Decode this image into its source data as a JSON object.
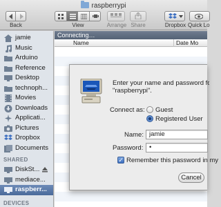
{
  "window": {
    "title": "raspberrypi"
  },
  "toolbar": {
    "back_label": "Back",
    "view_label": "View",
    "arrange_label": "Arrange",
    "share_label": "Share",
    "dropbox_label": "Dropbox",
    "quicklook_label": "Quick Lo",
    "view_modes": [
      "icon-view-icon",
      "list-view-icon",
      "column-view-icon",
      "coverflow-view-icon"
    ],
    "selected_view": "list-view-icon"
  },
  "sidebar": {
    "favorites": [
      {
        "label": "jamie",
        "icon": "home-icon"
      },
      {
        "label": "Music",
        "icon": "music-icon"
      },
      {
        "label": "Arduino",
        "icon": "folder-icon"
      },
      {
        "label": "Reference",
        "icon": "folder-icon"
      },
      {
        "label": "Desktop",
        "icon": "desktop-icon"
      },
      {
        "label": "technoph...",
        "icon": "folder-icon"
      },
      {
        "label": "Movies",
        "icon": "movies-icon"
      },
      {
        "label": "Downloads",
        "icon": "downloads-icon"
      },
      {
        "label": "Applicati...",
        "icon": "applications-icon"
      },
      {
        "label": "Pictures",
        "icon": "pictures-icon"
      },
      {
        "label": "Dropbox",
        "icon": "dropbox-icon"
      },
      {
        "label": "Documents",
        "icon": "documents-icon"
      }
    ],
    "shared_header": "SHARED",
    "shared": [
      {
        "label": "DiskSt...",
        "icon": "network-server-icon"
      },
      {
        "label": "mediace...",
        "icon": "network-server-icon"
      },
      {
        "label": "raspberr...",
        "icon": "network-server-icon",
        "selected": true
      }
    ],
    "devices_header": "DEVICES"
  },
  "content": {
    "connecting_text": "Connecting…",
    "columns": {
      "name": "Name",
      "date": "Date Mo"
    }
  },
  "dialog": {
    "prompt_line1": "Enter your name and password for t",
    "prompt_line2": "\"raspberrypi\".",
    "connect_as_label": "Connect as:",
    "guest_label": "Guest",
    "registered_label": "Registered User",
    "selected_option": "Registered User",
    "name_label": "Name:",
    "name_value": "jamie",
    "password_label": "Password:",
    "password_value": "•",
    "remember_label": "Remember this password in my",
    "remember_checked": true,
    "cancel_label": "Cancel"
  },
  "colors": {
    "sidebar_bg": "#dfe4ea",
    "selected_item": "#4a6a9a",
    "connecting_bar": "#546275",
    "accent": "#3d6fc0"
  }
}
